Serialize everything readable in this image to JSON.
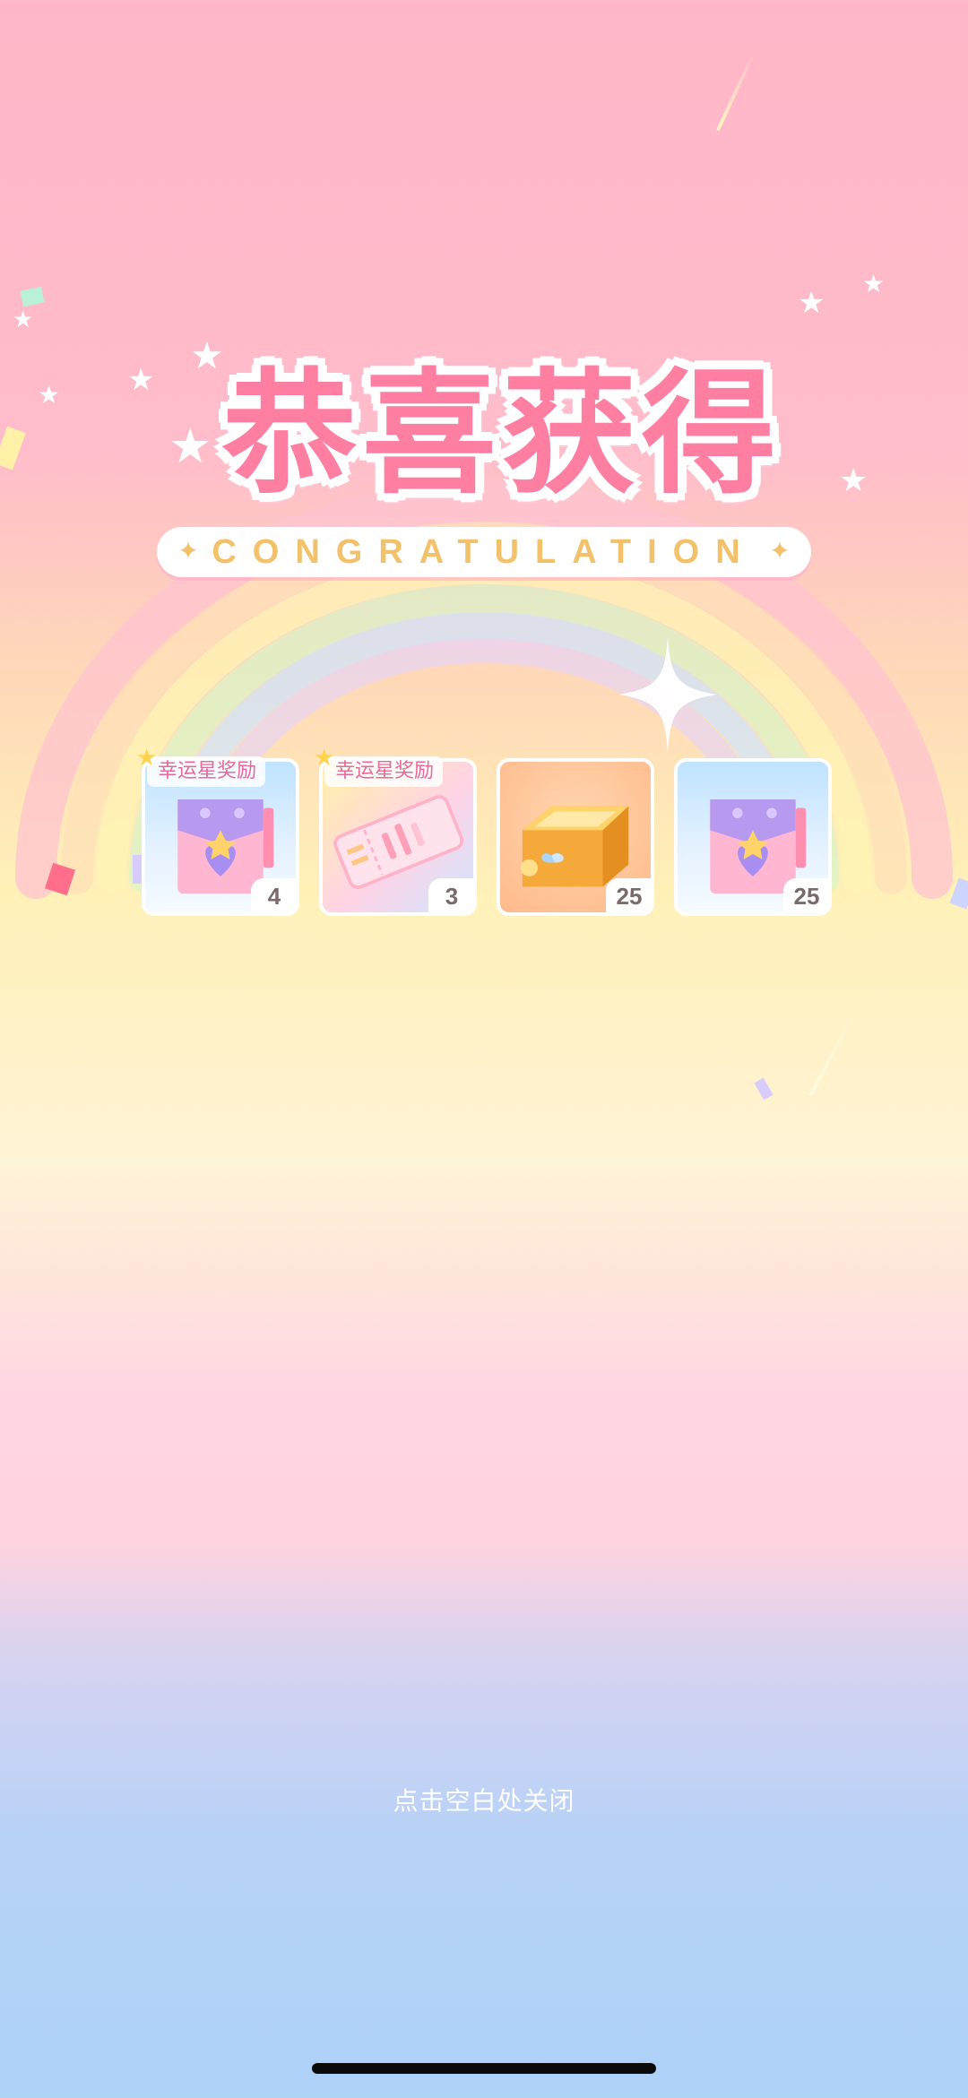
{
  "header": {
    "title": "恭喜获得",
    "subtitle": "CONGRATULATION"
  },
  "rewards": [
    {
      "icon": "gift-bag-icon",
      "count": "4",
      "tag": "幸运星奖励"
    },
    {
      "icon": "ticket-icon",
      "count": "3",
      "tag": "幸运星奖励"
    },
    {
      "icon": "treasure-box-icon",
      "count": "25",
      "tag": ""
    },
    {
      "icon": "gift-bag-icon",
      "count": "25",
      "tag": ""
    }
  ],
  "footer": {
    "close_hint": "点击空白处关闭"
  },
  "colors": {
    "title": "#ff7fa2",
    "subtitle": "#f2c16a",
    "tag_text": "#e56a9a"
  }
}
